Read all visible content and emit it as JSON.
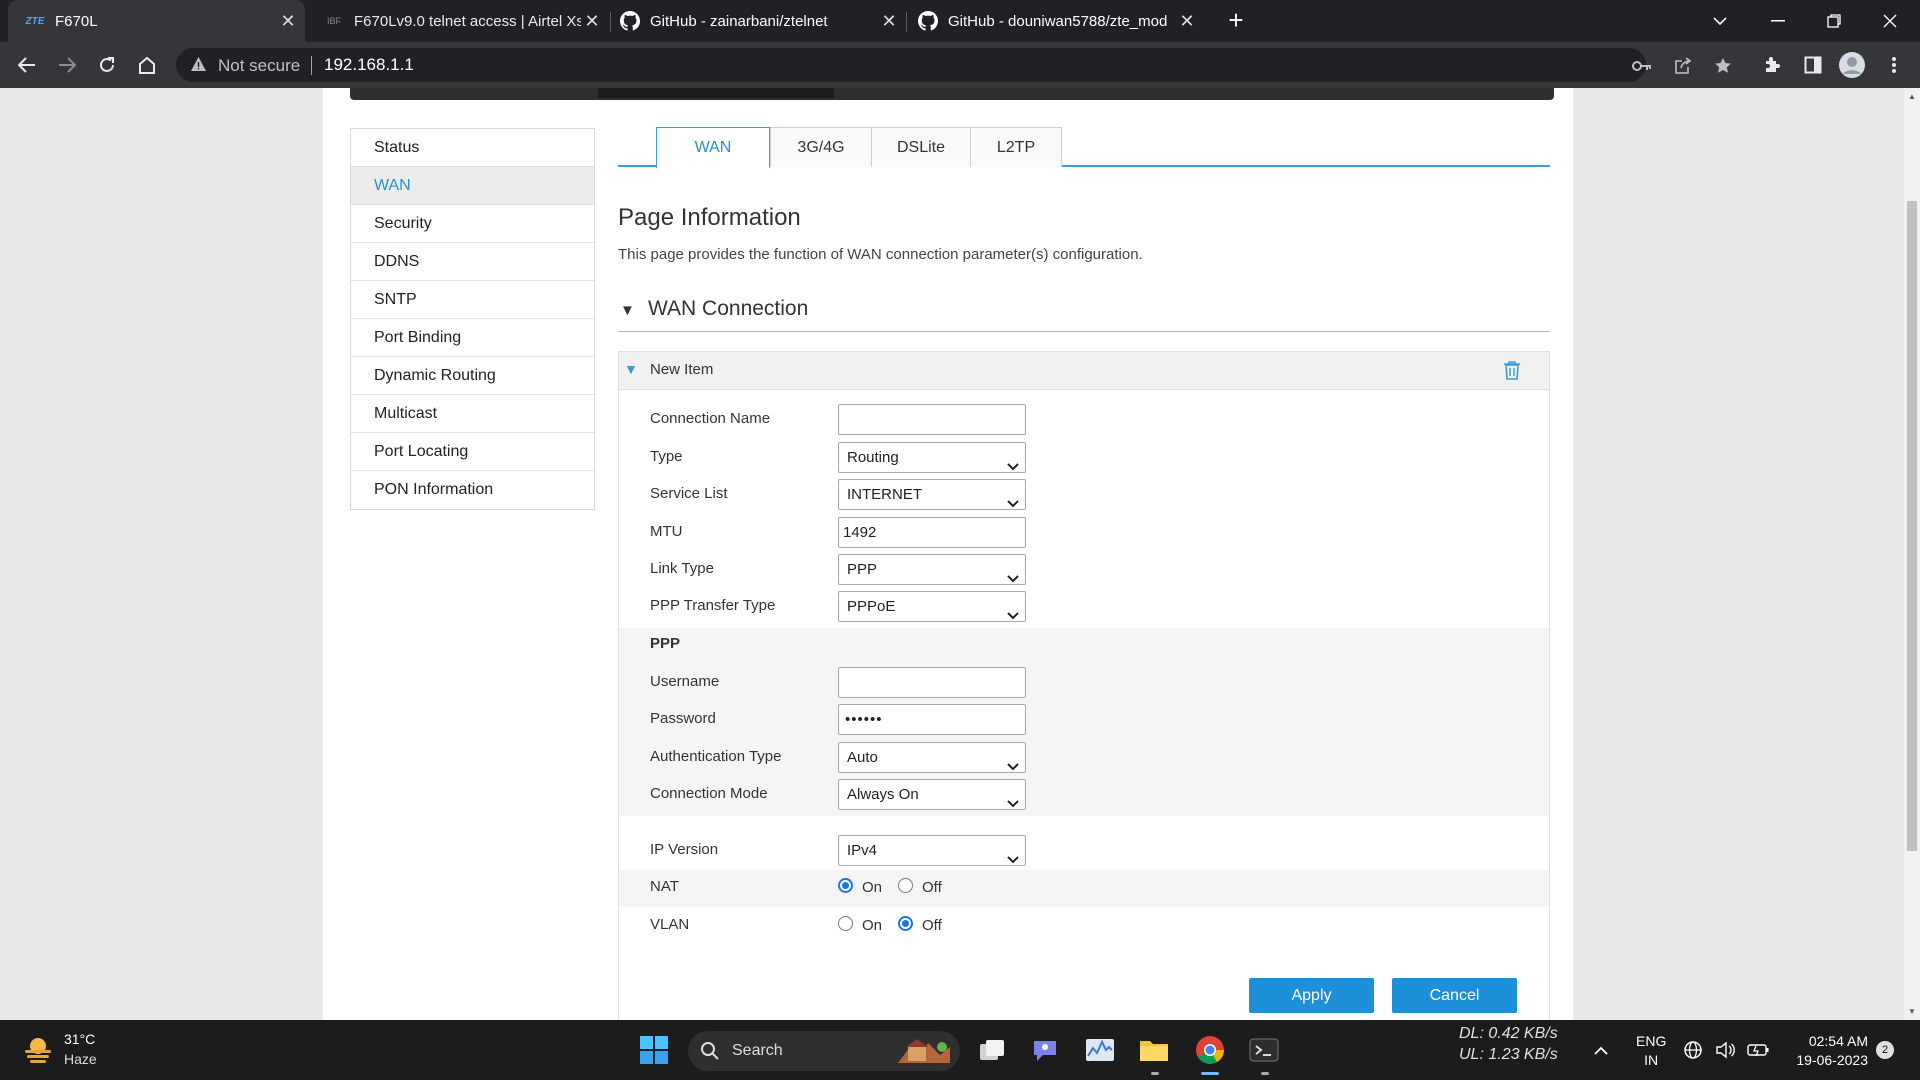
{
  "browser": {
    "tabs": [
      {
        "favicon": "ZTE",
        "title": "F670L",
        "active": true
      },
      {
        "favicon": "IBF",
        "title": "F670Lv9.0 telnet access | Airtel Xs",
        "active": false
      },
      {
        "favicon": "github-icon",
        "title": "GitHub - zainarbani/ztelnet",
        "active": false
      },
      {
        "favicon": "github-icon",
        "title": "GitHub - douniwan5788/zte_mod",
        "active": false
      }
    ],
    "security_label": "Not secure",
    "url": "192.168.1.1"
  },
  "sidebar": {
    "items": [
      {
        "label": "Status",
        "active": false
      },
      {
        "label": "WAN",
        "active": true
      },
      {
        "label": "Security",
        "active": false
      },
      {
        "label": "DDNS",
        "active": false
      },
      {
        "label": "SNTP",
        "active": false
      },
      {
        "label": "Port Binding",
        "active": false
      },
      {
        "label": "Dynamic Routing",
        "active": false
      },
      {
        "label": "Multicast",
        "active": false
      },
      {
        "label": "Port Locating",
        "active": false
      },
      {
        "label": "PON Information",
        "active": false
      }
    ]
  },
  "tabs": [
    {
      "label": "WAN",
      "active": true
    },
    {
      "label": "3G/4G",
      "active": false
    },
    {
      "label": "DSLite",
      "active": false
    },
    {
      "label": "L2TP",
      "active": false
    }
  ],
  "page": {
    "title": "Page Information",
    "description": "This page provides the function of WAN connection parameter(s) configuration.",
    "section_title": "WAN Connection",
    "item_title": "New Item"
  },
  "form": {
    "connection_name": {
      "label": "Connection Name",
      "value": ""
    },
    "type": {
      "label": "Type",
      "value": "Routing"
    },
    "service_list": {
      "label": "Service List",
      "value": "INTERNET"
    },
    "mtu": {
      "label": "MTU",
      "value": "1492"
    },
    "link_type": {
      "label": "Link Type",
      "value": "PPP"
    },
    "ppp_transfer_type": {
      "label": "PPP Transfer Type",
      "value": "PPPoE"
    },
    "ppp_heading": "PPP",
    "username": {
      "label": "Username",
      "value": ""
    },
    "password": {
      "label": "Password",
      "value": "••••••"
    },
    "auth_type": {
      "label": "Authentication Type",
      "value": "Auto"
    },
    "connection_mode": {
      "label": "Connection Mode",
      "value": "Always On"
    },
    "ip_version": {
      "label": "IP Version",
      "value": "IPv4"
    },
    "nat": {
      "label": "NAT",
      "on_label": "On",
      "off_label": "Off",
      "selected": "On"
    },
    "vlan": {
      "label": "VLAN",
      "on_label": "On",
      "off_label": "Off",
      "selected": "Off"
    },
    "apply_label": "Apply",
    "cancel_label": "Cancel"
  },
  "taskbar": {
    "weather_temp": "31°C",
    "weather_desc": "Haze",
    "search_label": "Search",
    "net_dl": "DL: 0.42 KB/s",
    "net_ul": "UL: 1.23 KB/s",
    "lang_line1": "ENG",
    "lang_line2": "IN",
    "time": "02:54 AM",
    "date": "19-06-2023",
    "notification_count": "2"
  },
  "colors": {
    "accent": "#3a9bd8",
    "button": "#1e90d9",
    "active_text": "#2a8fc9"
  }
}
